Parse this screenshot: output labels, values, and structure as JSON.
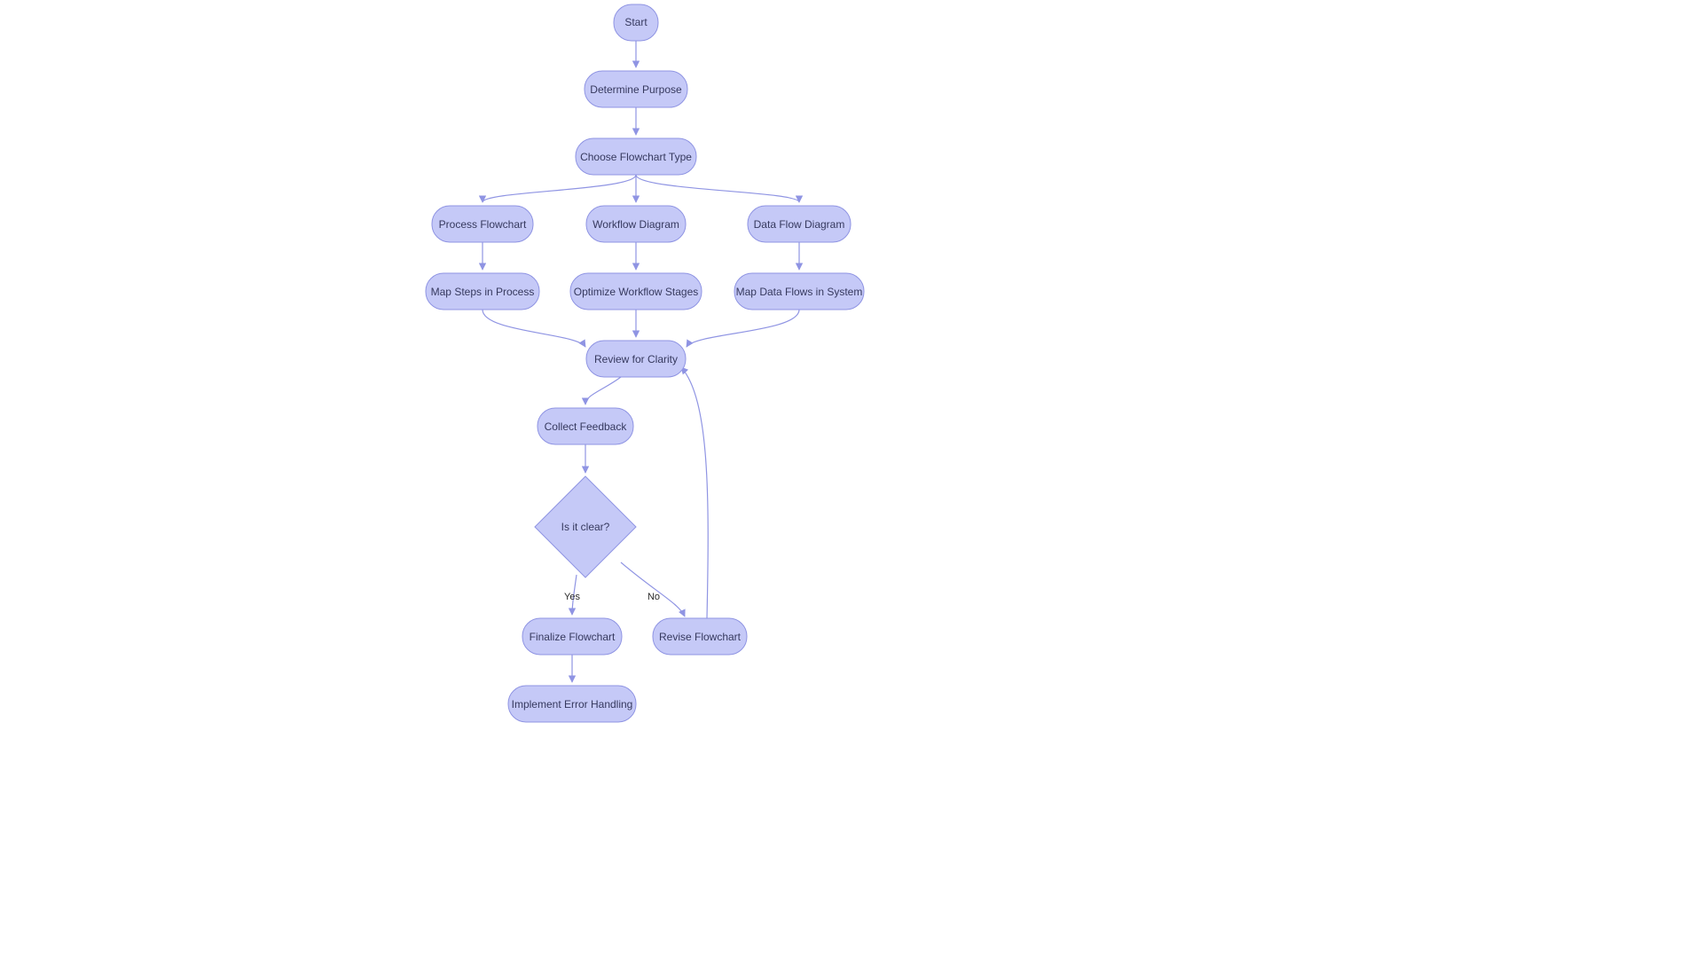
{
  "nodes": {
    "start": "Start",
    "determine": "Determine Purpose",
    "choose": "Choose Flowchart Type",
    "process": "Process Flowchart",
    "workflow": "Workflow Diagram",
    "dataflow": "Data Flow Diagram",
    "mapsteps": "Map Steps in Process",
    "optimize": "Optimize Workflow Stages",
    "mapdata": "Map Data Flows in System",
    "review": "Review for Clarity",
    "collect": "Collect Feedback",
    "clear": "Is it clear?",
    "finalize": "Finalize Flowchart",
    "revise": "Revise Flowchart",
    "implement": "Implement Error Handling"
  },
  "edges": {
    "yes": "Yes",
    "no": "No"
  },
  "colors": {
    "nodeFill": "#c5c9f7",
    "nodeStroke": "#8f94e3",
    "nodeText": "#36395e",
    "edge": "#8f94e3"
  }
}
